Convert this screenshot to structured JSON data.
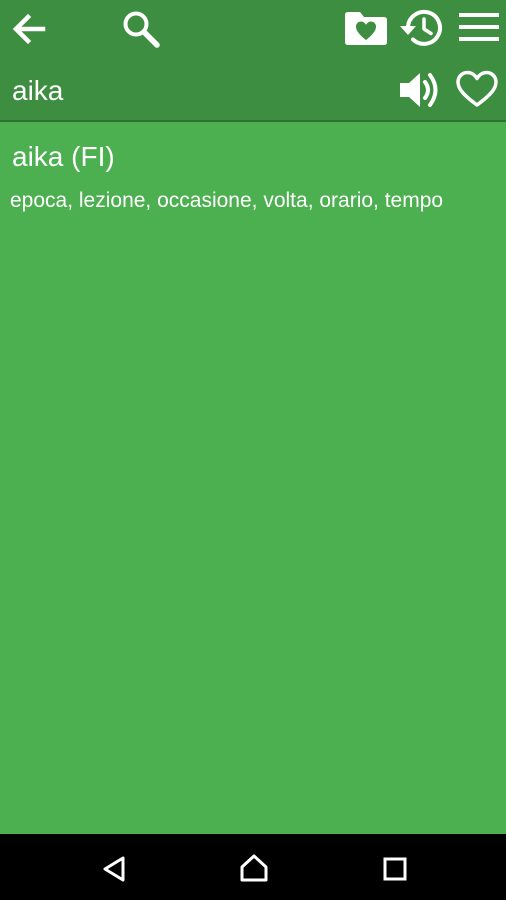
{
  "toolbar": {
    "icons": [
      "back-arrow-icon",
      "search-icon",
      "favorites-folder-icon",
      "history-icon",
      "menu-icon"
    ]
  },
  "entry_bar": {
    "word": "aika",
    "icons": [
      "speaker-icon",
      "heart-outline-icon"
    ]
  },
  "entry": {
    "headword": "aika (FI)",
    "translation": "epoca, lezione, occasione, volta, orario, tempo"
  },
  "navbar": {
    "icons": [
      "back-triangle-icon",
      "home-icon",
      "recents-square-icon"
    ]
  },
  "colors": {
    "toolbar": "#3e8e41",
    "background": "#4caf50",
    "text": "#ffffff",
    "navbar": "#000000"
  }
}
